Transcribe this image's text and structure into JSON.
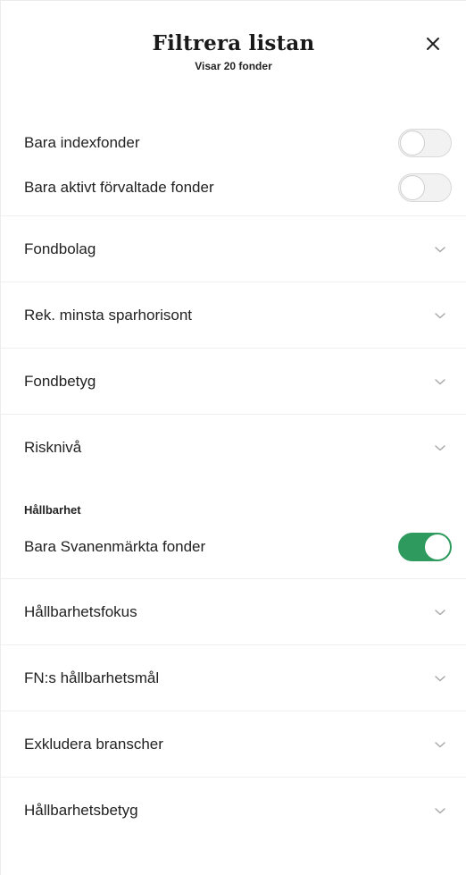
{
  "header": {
    "title": "Filtrera listan",
    "subtitle": "Visar 20 fonder"
  },
  "toggles": [
    {
      "label": "Bara indexfonder",
      "on": false
    },
    {
      "label": "Bara aktivt förvaltade fonder",
      "on": false
    }
  ],
  "filters": [
    {
      "label": "Fondbolag"
    },
    {
      "label": "Rek. minsta sparhorisont"
    },
    {
      "label": "Fondbetyg"
    },
    {
      "label": "Risknivå"
    }
  ],
  "sustainability": {
    "heading": "Hållbarhet",
    "toggle": {
      "label": "Bara Svanenmärkta fonder",
      "on": true
    },
    "filters": [
      {
        "label": "Hållbarhetsfokus"
      },
      {
        "label": "FN:s hållbarhetsmål"
      },
      {
        "label": "Exkludera branscher"
      },
      {
        "label": "Hållbarhetsbetyg"
      }
    ]
  },
  "icons": {
    "close": "close-icon",
    "expand": "chevron-down-icon"
  },
  "colors": {
    "toggle_on": "#2e9a5d",
    "toggle_off": "#f2f2f2",
    "chevron": "#a8a8a8"
  }
}
